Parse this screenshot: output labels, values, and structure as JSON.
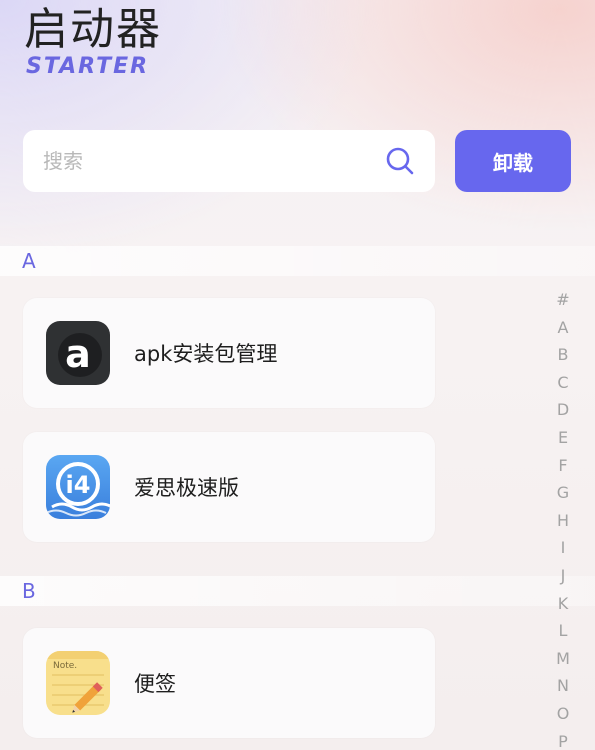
{
  "header": {
    "title": "启动器",
    "subtitle": "STARTER"
  },
  "search": {
    "placeholder": "搜索"
  },
  "toolbar": {
    "uninstall_label": "卸载"
  },
  "sections": [
    {
      "letter": "A",
      "apps": [
        {
          "name": "apk安装包管理",
          "icon": "apk-installer-icon"
        },
        {
          "name": "爱思极速版",
          "icon": "i4-aisi-icon"
        }
      ]
    },
    {
      "letter": "B",
      "apps": [
        {
          "name": "便签",
          "icon": "note-pencil-icon"
        }
      ]
    }
  ],
  "alphabet": [
    "#",
    "A",
    "B",
    "C",
    "D",
    "E",
    "F",
    "G",
    "H",
    "I",
    "J",
    "K",
    "L",
    "M",
    "N",
    "O",
    "P"
  ],
  "colors": {
    "accent": "#6767ee",
    "section_text": "#6a67e0",
    "index_text": "#a3a3a3"
  }
}
